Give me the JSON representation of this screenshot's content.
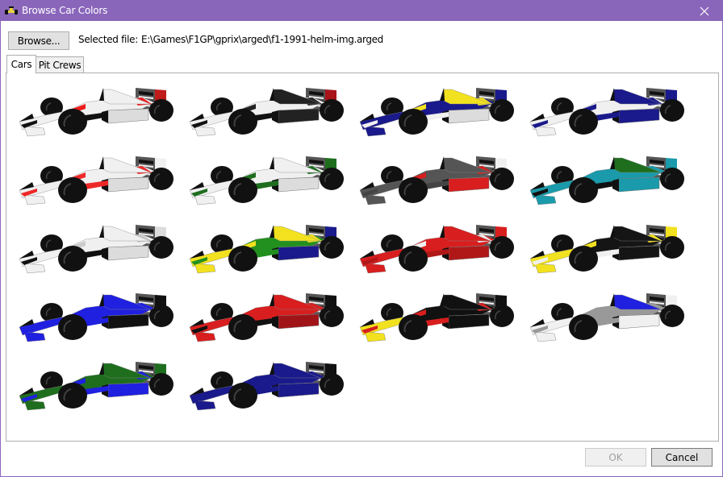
{
  "window": {
    "title": "Browse Car Colors",
    "accent_color": "#8a66bb",
    "close_icon": "close-icon",
    "app_icon": "race-car-icon"
  },
  "header": {
    "browse_label": "Browse...",
    "selected_file_label": "Selected file:",
    "selected_file_value": "E:\\Games\\F1GP\\gprix\\arged\\f1-1991-helm-img.arged"
  },
  "tabs": [
    {
      "label": "Cars",
      "active": true
    },
    {
      "label": "Pit Crews",
      "active": false
    }
  ],
  "cars": [
    {
      "name": "car-1",
      "body": "#f0f0f0",
      "cockpit": "#f0f0f0",
      "sidepod": "#dcdcdc",
      "nose": "#f0f0f0",
      "accent": "#ee1c1c",
      "wing": "#c01a1a",
      "stripe": "#111111"
    },
    {
      "name": "car-2",
      "body": "#f0f0f0",
      "cockpit": "#222222",
      "sidepod": "#222222",
      "nose": "#f0f0f0",
      "accent": "#222222",
      "wing": "#a8141a",
      "stripe": "#111111"
    },
    {
      "name": "car-3",
      "body": "#1a1a8c",
      "cockpit": "#f2e11e",
      "sidepod": "#dcdcdc",
      "nose": "#1a1a8c",
      "accent": "#f2e11e",
      "wing": "#1a1a8c",
      "stripe": "#f0f0f0"
    },
    {
      "name": "car-4",
      "body": "#f0f0f0",
      "cockpit": "#1a1a8c",
      "sidepod": "#1a1a8c",
      "nose": "#f0f0f0",
      "accent": "#1a1a8c",
      "wing": "#1a1a8c",
      "stripe": "#1a1a8c"
    },
    {
      "name": "car-5",
      "body": "#f0f0f0",
      "cockpit": "#f0f0f0",
      "sidepod": "#dcdcdc",
      "nose": "#f0f0f0",
      "accent": "#ee2828",
      "wing": "#f0f0f0",
      "stripe": "#ee2828"
    },
    {
      "name": "car-6",
      "body": "#f0f0f0",
      "cockpit": "#f0f0f0",
      "sidepod": "#dcdcdc",
      "nose": "#f0f0f0",
      "accent": "#1e6e1e",
      "wing": "#1e6e1e",
      "stripe": "#1e6e1e"
    },
    {
      "name": "car-7",
      "body": "#555555",
      "cockpit": "#555555",
      "sidepod": "#d81e1e",
      "nose": "#555555",
      "accent": "#d81e1e",
      "wing": "#f0f0f0",
      "stripe": "#444444"
    },
    {
      "name": "car-8",
      "body": "#1a9aaa",
      "cockpit": "#1e6e1e",
      "sidepod": "#1a9aaa",
      "nose": "#1a9aaa",
      "accent": "#1a9aaa",
      "wing": "#1a9aaa",
      "stripe": "#111111"
    },
    {
      "name": "car-9",
      "body": "#f0f0f0",
      "cockpit": "#f0f0f0",
      "sidepod": "#dcdcdc",
      "nose": "#f0f0f0",
      "accent": "#cccccc",
      "wing": "#dcdcdc",
      "stripe": "#111111"
    },
    {
      "name": "car-10",
      "body": "#22901e",
      "cockpit": "#f2e11e",
      "sidepod": "#1a1a8c",
      "nose": "#f2e11e",
      "accent": "#f2e11e",
      "wing": "#1a1a8c",
      "stripe": "#22901e"
    },
    {
      "name": "car-11",
      "body": "#d81e1e",
      "cockpit": "#d81e1e",
      "sidepod": "#b01818",
      "nose": "#d81e1e",
      "accent": "#f0f0f0",
      "wing": "#d81e1e",
      "stripe": "#b01818"
    },
    {
      "name": "car-12",
      "body": "#151515",
      "cockpit": "#151515",
      "sidepod": "#151515",
      "nose": "#f2e11e",
      "accent": "#f2e11e",
      "wing": "#f2e11e",
      "stripe": "#f0f0f0"
    },
    {
      "name": "car-13",
      "body": "#2020e0",
      "cockpit": "#2020e0",
      "sidepod": "#111111",
      "nose": "#2020e0",
      "accent": "#2020e0",
      "wing": "#111111",
      "stripe": "#2020e0"
    },
    {
      "name": "car-14",
      "body": "#d81e1e",
      "cockpit": "#d81e1e",
      "sidepod": "#a01418",
      "nose": "#d81e1e",
      "accent": "#d81e1e",
      "wing": "#111111",
      "stripe": "#111111"
    },
    {
      "name": "car-15",
      "body": "#111111",
      "cockpit": "#111111",
      "sidepod": "#111111",
      "nose": "#f2e11e",
      "accent": "#d81e1e",
      "wing": "#111111",
      "stripe": "#d81e1e"
    },
    {
      "name": "car-16",
      "body": "#999999",
      "cockpit": "#2020e0",
      "sidepod": "#f0f0f0",
      "nose": "#f0f0f0",
      "accent": "#999999",
      "wing": "#f0f0f0",
      "stripe": "#999999"
    },
    {
      "name": "car-17",
      "body": "#1e6e1e",
      "cockpit": "#1e6e1e",
      "sidepod": "#2020e0",
      "nose": "#1e6e1e",
      "accent": "#2020e0",
      "wing": "#1e6e1e",
      "stripe": "#2020e0"
    },
    {
      "name": "car-18",
      "body": "#1a1a8c",
      "cockpit": "#1a1a8c",
      "sidepod": "#1a1a8c",
      "nose": "#1a1a8c",
      "accent": "#1a1a8c",
      "wing": "#111111",
      "stripe": "#1a1a8c"
    }
  ],
  "footer": {
    "ok_label": "OK",
    "ok_enabled": false,
    "cancel_label": "Cancel"
  }
}
